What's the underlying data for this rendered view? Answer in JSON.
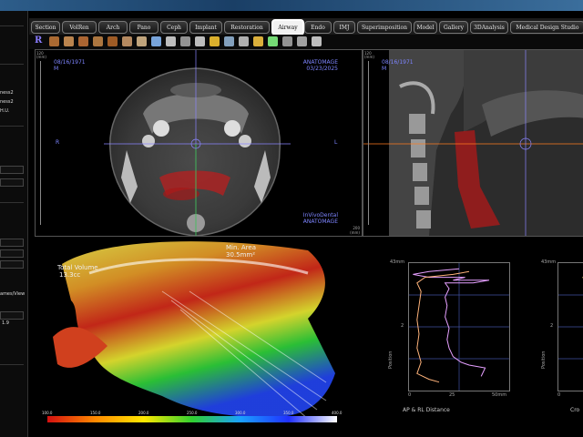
{
  "tabs": [
    "Section",
    "VolRen",
    "Arch",
    "Pano",
    "Ceph",
    "Implant",
    "Restoration",
    "Airway",
    "Endo",
    "IMJ",
    "Superimposition",
    "Model",
    "Gallery",
    "3DAnalysis",
    "Medical Design Studio"
  ],
  "active_tab": "Airway",
  "toolbar_first_label": "R",
  "left_panel": {
    "items": [
      "ness2",
      "ness2",
      "H.U.",
      "ames/View",
      "1.9"
    ]
  },
  "axial_view": {
    "top_left": [
      "08/16/1971",
      "M"
    ],
    "top_right": [
      "ANATOMAGE",
      "03/23/2025"
    ],
    "left_marker": "R",
    "right_marker": "L",
    "bottom_right": [
      "InVivoDental",
      "ANATOMAGE"
    ],
    "ruler_top": "120",
    "ruler_unit": "(mm)",
    "ruler_bottom": "200"
  },
  "sagittal_view": {
    "top_left": [
      "08/16/1971",
      "M"
    ],
    "ruler_top": "120",
    "ruler_unit": "(mm)"
  },
  "volume_view": {
    "total_volume_label": "Total Volume",
    "total_volume_value": "13.3cc",
    "min_area_label": "Min. Area",
    "min_area_value": "30.5mm²",
    "scale_labels": [
      "100.0",
      "150.0",
      "200.0",
      "250.0",
      "300.0",
      "350.0",
      "400.0"
    ]
  },
  "chart_data": [
    {
      "type": "line",
      "title": "AP & RL Distance",
      "ylabel": "Position",
      "y_top_label": "43mm",
      "y_mid_label": "2",
      "x_ticks": [
        "0",
        "25",
        "50mm"
      ],
      "series": [
        {
          "color": "#e6a0ff",
          "values": [
            [
              25,
              43
            ],
            [
              10,
              42
            ],
            [
              2,
              41
            ],
            [
              10,
              40
            ],
            [
              28,
              40
            ],
            [
              22,
              39
            ],
            [
              40,
              39
            ],
            [
              32,
              38
            ],
            [
              18,
              38
            ],
            [
              20,
              36
            ],
            [
              18,
              33
            ],
            [
              19,
              30
            ],
            [
              18,
              26
            ],
            [
              20,
              22
            ],
            [
              19,
              18
            ],
            [
              20,
              15
            ],
            [
              22,
              12
            ],
            [
              26,
              10
            ],
            [
              30,
              9
            ],
            [
              38,
              8
            ],
            [
              36,
              5
            ]
          ]
        },
        {
          "color": "#ffb37a",
          "values": [
            [
              30,
              42
            ],
            [
              22,
              41
            ],
            [
              8,
              40
            ],
            [
              4,
              38
            ],
            [
              6,
              35
            ],
            [
              5,
              30
            ],
            [
              4,
              25
            ],
            [
              5,
              20
            ],
            [
              4,
              15
            ],
            [
              6,
              10
            ],
            [
              4,
              6
            ],
            [
              10,
              4
            ],
            [
              15,
              3
            ]
          ]
        }
      ]
    },
    {
      "type": "line",
      "title": "Cro",
      "ylabel": "Position",
      "y_top_label": "43mm",
      "y_mid_label": "2",
      "x_ticks": [
        "0"
      ],
      "series": [
        {
          "color": "#ffe070",
          "values": [
            [
              12,
              40
            ],
            [
              20,
              38
            ],
            [
              26,
              34
            ],
            [
              22,
              30
            ],
            [
              28,
              26
            ],
            [
              20,
              22
            ],
            [
              18,
              18
            ]
          ]
        }
      ]
    }
  ]
}
